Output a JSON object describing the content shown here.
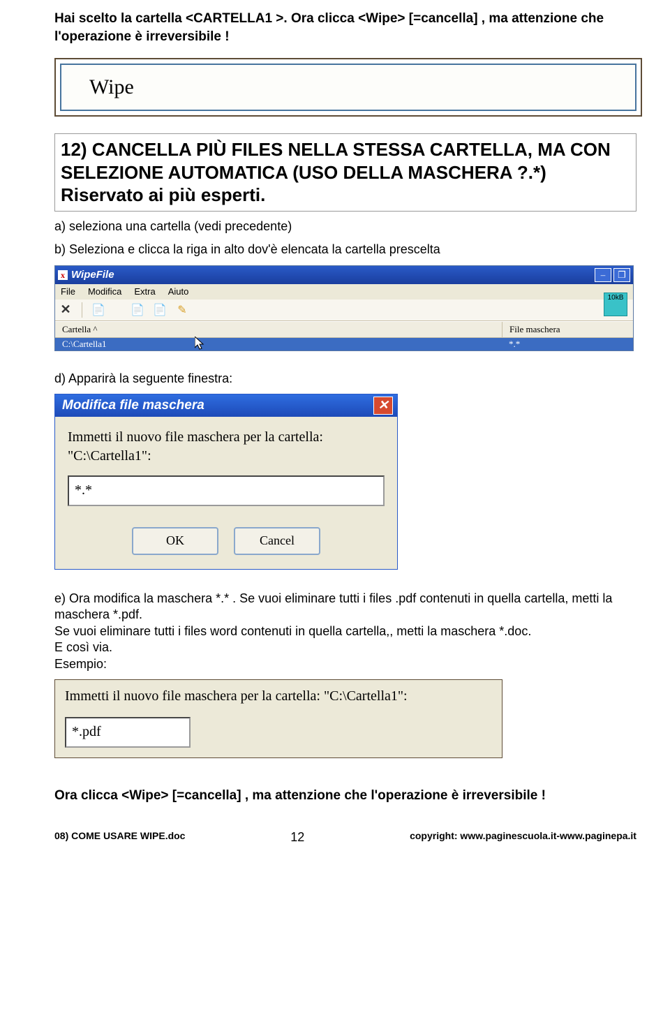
{
  "intro": {
    "line1": "Hai scelto la cartella  <CARTELLA1 >. Ora clicca <Wipe> [=cancella] , ma attenzione che l'operazione è irreversibile !"
  },
  "wipe_button_label": "Wipe",
  "heading": "12) CANCELLA   PIÙ  FILES NELLA STESSA CARTELLA, MA CON SELEZIONE AUTOMATICA (USO DELLA MASCHERA  ?.*) Riservato ai più esperti.",
  "step_a": "a)  seleziona una cartella (vedi precedente)",
  "step_b": "b) Seleziona e clicca la riga in alto dov'è elencata la cartella prescelta",
  "app": {
    "title": "WipeFile",
    "menus": [
      "File",
      "Modifica",
      "Extra",
      "Aiuto"
    ],
    "badge": "10kB",
    "col1": "Cartella  ^",
    "col2": "File maschera",
    "row_path": "C:\\Cartella1",
    "row_mask": "*.*"
  },
  "step_d": "d) Apparirà la seguente finestra:",
  "dialog": {
    "title": "Modifica file maschera",
    "label": "Immetti il nuovo file maschera per la cartella: \"C:\\Cartella1\":",
    "value": "*.*",
    "ok": "OK",
    "cancel": "Cancel"
  },
  "step_e": "e) Ora modifica la maschera  *.* . Se vuoi eliminare tutti i files .pdf contenuti in quella cartella, metti la maschera   *.pdf.\nSe vuoi eliminare tutti i files word contenuti in quella cartella,, metti la maschera   *.doc.\nE così via.\nEsempio:",
  "snippet": {
    "label": "Immetti il nuovo file maschera per la cartella: \"C:\\Cartella1\":",
    "value": "*.pdf"
  },
  "final": "Ora clicca <Wipe> [=cancella] , ma attenzione che l'operazione è irreversibile !",
  "footer": {
    "left": "08) COME USARE WIPE.doc",
    "page": "12",
    "right": "copyright: www.paginescuola.it-www.paginepa.it"
  }
}
